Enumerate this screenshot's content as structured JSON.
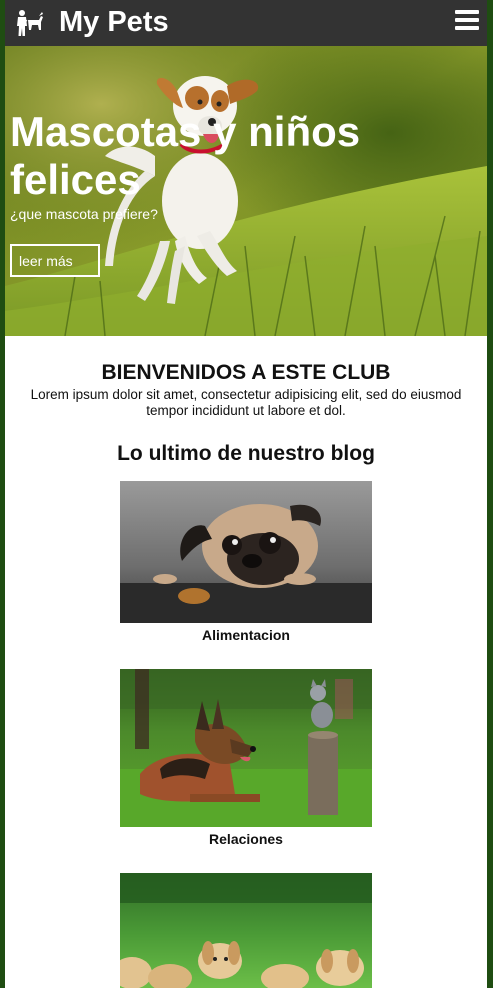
{
  "header": {
    "brand": "My Pets",
    "logo_icon": "pets-logo-icon",
    "menu_icon": "hamburger-menu-icon",
    "background": "#333333"
  },
  "hero": {
    "title": "Mascotas y niños felices",
    "subtitle": "¿que mascota prefiere?",
    "button_label": "leer más",
    "image": "dog-jumping-on-grass"
  },
  "welcome": {
    "title": "BIENVENIDOS A ESTE CLUB",
    "text": "Lorem ipsum dolor sit amet, consectetur adipisicing elit, sed do eiusmod tempor incididunt ut labore et dol."
  },
  "blog": {
    "title": "Lo ultimo de nuestro blog",
    "posts": [
      {
        "caption": "Alimentacion",
        "image": "pug-with-cookie"
      },
      {
        "caption": "Relaciones",
        "image": "german-shepherd-and-kitten"
      },
      {
        "caption": "",
        "image": "puppies-on-grass"
      }
    ]
  }
}
